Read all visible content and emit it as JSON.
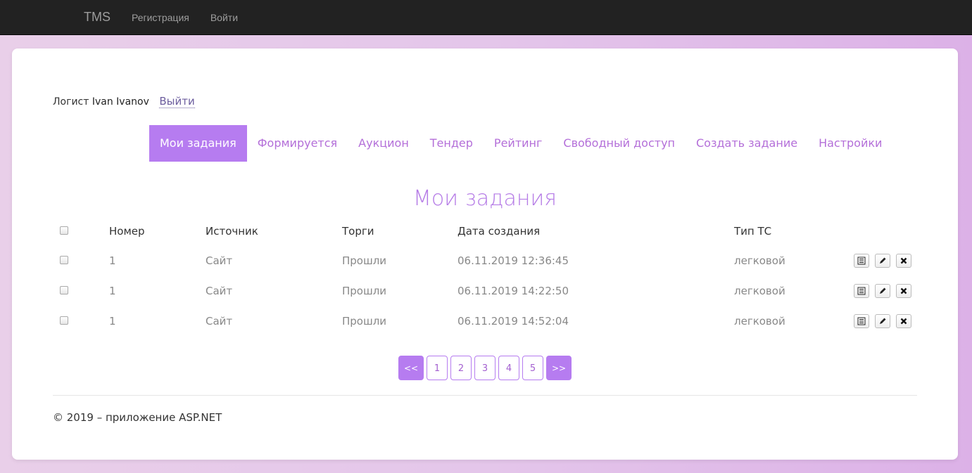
{
  "navbar": {
    "brand": "TMS",
    "links": [
      "Регистрация",
      "Войти"
    ]
  },
  "user": {
    "role": "Логист",
    "name": "Ivan Ivanov",
    "logout": "Выйти"
  },
  "tabs": [
    {
      "label": "Мои задания",
      "active": true
    },
    {
      "label": "Формируется",
      "active": false
    },
    {
      "label": "Аукцион",
      "active": false
    },
    {
      "label": "Тендер",
      "active": false
    },
    {
      "label": "Рейтинг",
      "active": false
    },
    {
      "label": "Свободный доступ",
      "active": false
    },
    {
      "label": "Создать задание",
      "active": false
    },
    {
      "label": "Настройки",
      "active": false
    }
  ],
  "page_title": "Мои задания",
  "table": {
    "headers": {
      "number": "Номер",
      "source": "Источник",
      "trades": "Торги",
      "created": "Дата создания",
      "vehicle": "Тип ТС"
    },
    "rows": [
      {
        "number": "1",
        "source": "Сайт",
        "trades": "Прошли",
        "created": "06.11.2019 12:36:45",
        "vehicle": "легковой"
      },
      {
        "number": "1",
        "source": "Сайт",
        "trades": "Прошли",
        "created": "06.11.2019 14:22:50",
        "vehicle": "легковой"
      },
      {
        "number": "1",
        "source": "Сайт",
        "trades": "Прошли",
        "created": "06.11.2019 14:52:04",
        "vehicle": "легковой"
      }
    ]
  },
  "pager": {
    "prev": "<<",
    "pages": [
      "1",
      "2",
      "3",
      "4",
      "5"
    ],
    "next": ">>"
  },
  "footer": "© 2019 – приложение ASP.NET",
  "colors": {
    "accent": "#b67cf0",
    "link": "#b46fd9",
    "navbar": "#222222"
  },
  "icons": {
    "row_actions": [
      "list-icon",
      "pencil-icon",
      "close-icon"
    ]
  }
}
